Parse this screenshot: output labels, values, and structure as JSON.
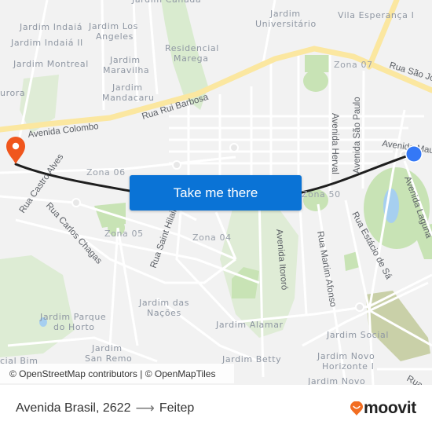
{
  "map": {
    "place_labels": [
      {
        "text": "Jardim Canadá"
      },
      {
        "text": "Jardim Indaiá"
      },
      {
        "text": "Jardim Los"
      },
      {
        "text": "Angeles"
      },
      {
        "text": "Jardim Indaiá II"
      },
      {
        "text": "Residencial"
      },
      {
        "text": "Marega"
      },
      {
        "text": "Jardim Montreal"
      },
      {
        "text": "Jardim"
      },
      {
        "text": "Maravilha"
      },
      {
        "text": "Jardim"
      },
      {
        "text": "Mandacaru"
      },
      {
        "text": "urora"
      },
      {
        "text": "Jardim"
      },
      {
        "text": "Universitário"
      },
      {
        "text": "Vila Esperança I"
      },
      {
        "text": "Jardim das"
      },
      {
        "text": "Nações"
      },
      {
        "text": "Jardim Parque"
      },
      {
        "text": "do Horto"
      },
      {
        "text": "Jardim"
      },
      {
        "text": "San Remo"
      },
      {
        "text": "Jardim Alamar"
      },
      {
        "text": "Jardim Social"
      },
      {
        "text": "Jardim Betty"
      },
      {
        "text": "Jardim Novo"
      },
      {
        "text": "Horizonte I"
      },
      {
        "text": "Jardim Novo"
      },
      {
        "text": "cial Bim"
      }
    ],
    "zone_labels": [
      {
        "text": "Zona 07"
      },
      {
        "text": "Zona 06"
      },
      {
        "text": "Zona 50"
      },
      {
        "text": "Zona 05"
      },
      {
        "text": "Zona 04"
      }
    ],
    "street_labels": [
      {
        "text": "Avenida Colombo"
      },
      {
        "text": "Rua Rui Barbosa"
      },
      {
        "text": "Rua São Jo"
      },
      {
        "text": "Avenida São Paulo"
      },
      {
        "text": "Avenida Herval"
      },
      {
        "text": "Avenida Mau"
      },
      {
        "text": "Avenida Laguna"
      },
      {
        "text": "Rua Castro Alves"
      },
      {
        "text": "Rua Carlos Chagas"
      },
      {
        "text": "Rua Saint Hilaire"
      },
      {
        "text": "Avenida Itororó"
      },
      {
        "text": "Rua Martim Afonso"
      },
      {
        "text": "Rua Estácio de Sá"
      },
      {
        "text": "Rua"
      }
    ],
    "origin_marker": {
      "icon": "blue-dot-icon",
      "color": "#3478f6"
    },
    "destination_marker": {
      "icon": "map-pin-icon",
      "color": "#f0561d"
    },
    "route_color": "#1e1e1e",
    "call_to_action": "Take me there",
    "attribution": "© OpenStreetMap contributors | © OpenMapTiles"
  },
  "footer": {
    "origin": "Avenida Brasil, 2622",
    "arrow": "⟶",
    "destination": "Feitep",
    "brand": "moovit",
    "brand_color": "#f26d21"
  }
}
